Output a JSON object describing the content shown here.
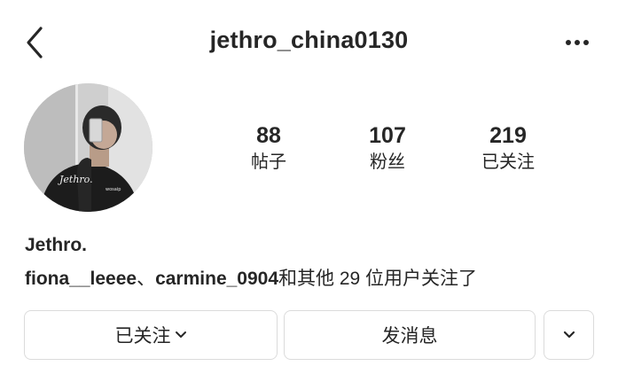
{
  "header": {
    "username": "jethro_china0130",
    "back_icon": "chevron-left-icon",
    "more_icon": "more-horizontal-icon"
  },
  "profile": {
    "avatar_caption": "Jethro.",
    "stats": [
      {
        "value": "88",
        "label": "帖子"
      },
      {
        "value": "107",
        "label": "粉丝"
      },
      {
        "value": "219",
        "label": "已关注"
      }
    ],
    "bio_name": "Jethro.",
    "followed_by": {
      "user1": "fiona__leeee",
      "separator": "、",
      "user2": "carmine_0904",
      "suffix": "和其他 29 位用户关注了"
    }
  },
  "actions": {
    "following_label": "已关注",
    "message_label": "发消息",
    "dropdown_icon": "chevron-down-icon"
  }
}
